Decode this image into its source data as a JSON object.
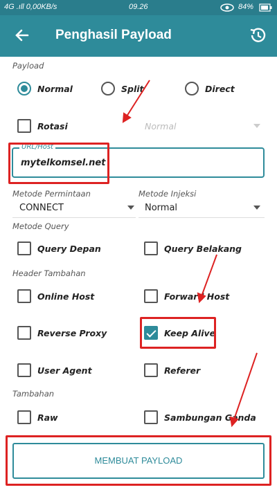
{
  "status": {
    "left": "4G .ıll  0,00KB/s",
    "time": "09.26",
    "battery": "84%"
  },
  "appbar": {
    "title": "Penghasil Payload"
  },
  "payload": {
    "section": "Payload",
    "options": [
      "Normal",
      "Split",
      "Direct"
    ],
    "selected": "Normal"
  },
  "rotasi": {
    "label": "Rotasi",
    "dropdown": "Normal"
  },
  "url": {
    "label": "URL/Host",
    "value": "mytelkomsel.net"
  },
  "methods": {
    "request_label": "Metode Permintaan",
    "request_value": "CONNECT",
    "inject_label": "Metode Injeksi",
    "inject_value": "Normal"
  },
  "query": {
    "section": "Metode Query",
    "front": "Query Depan",
    "back": "Query Belakang"
  },
  "headers": {
    "section": "Header Tambahan",
    "online_host": "Online Host",
    "forward_host": "Forward Host",
    "reverse_proxy": "Reverse Proxy",
    "keep_alive": "Keep Alive",
    "user_agent": "User Agent",
    "referer": "Referer"
  },
  "extras": {
    "section": "Tambahan",
    "raw": "Raw",
    "double": "Sambungan Ganda"
  },
  "button": {
    "label": "MEMBUAT PAYLOAD"
  },
  "colors": {
    "accent": "#2e8b9a",
    "highlight": "#d22222"
  }
}
